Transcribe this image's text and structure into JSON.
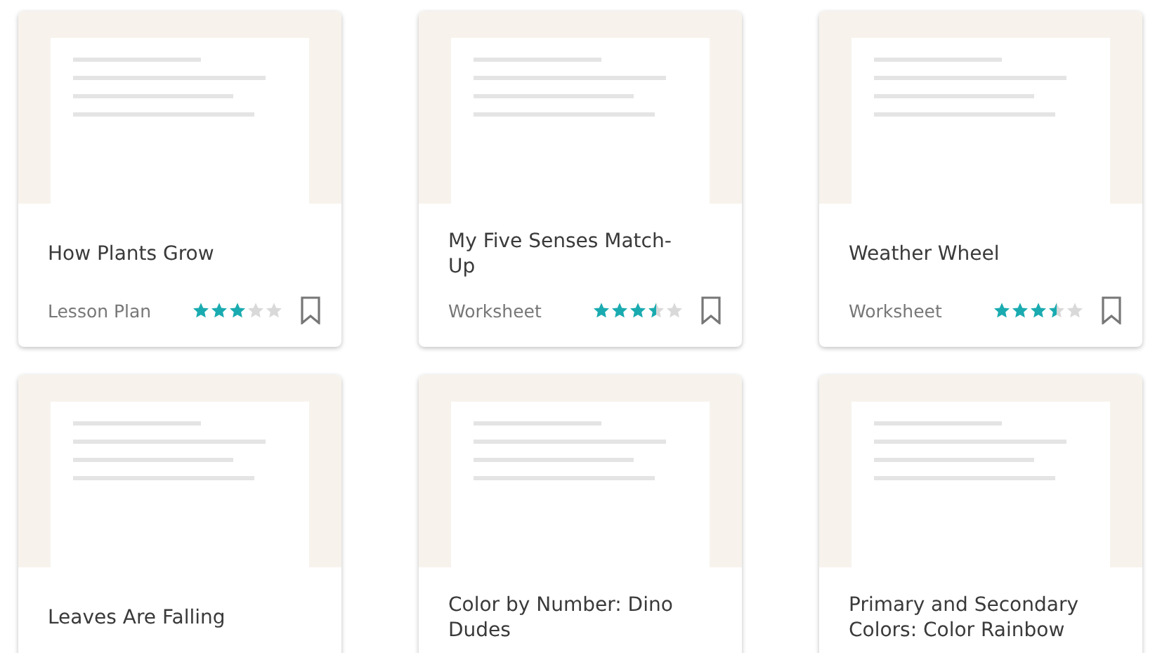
{
  "cards": [
    {
      "title": "How Plants Grow",
      "type": "Lesson Plan",
      "stars": 3,
      "bookmarked": false
    },
    {
      "title": "My Five Senses Match-Up",
      "type": "Worksheet",
      "stars": 3.5,
      "bookmarked": false
    },
    {
      "title": "Weather Wheel",
      "type": "Worksheet",
      "stars": 3.5,
      "bookmarked": false
    },
    {
      "title": "Leaves Are Falling"
    },
    {
      "title": "Color by Number: Dino Dudes"
    },
    {
      "title": "Primary and Secondary Colors: Color Rainbow"
    }
  ]
}
